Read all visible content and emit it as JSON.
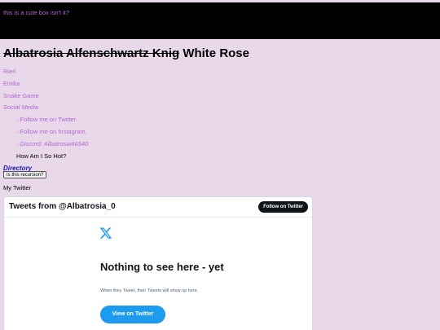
{
  "cute_box": {
    "text": "this is a cute box isn't it?"
  },
  "title": {
    "struck": "Albatrosia Alfenschwartz Knig",
    "rest": " White Rose"
  },
  "nav": {
    "items": [
      {
        "label": "Rieri"
      },
      {
        "label": "Emilia"
      },
      {
        "label": "Snake Game"
      },
      {
        "label": "Social Media"
      }
    ],
    "social": [
      {
        "bullet": "○",
        "label": "Follow me on Twitter."
      },
      {
        "bullet": "○",
        "label": "Follow me on Instagram."
      },
      {
        "bullet": "○",
        "label": "Discord: Albatrosia#6540"
      }
    ],
    "plain": "How Am I So Hot?"
  },
  "directory": {
    "label": "Directory",
    "button_label": "Is this recursion?"
  },
  "my_twitter": "My Twitter",
  "twitter_widget": {
    "header_title": "Tweets from @Albatrosia_0",
    "follow_label": "Follow on Twitter",
    "logo_icon": "x-logo-icon",
    "empty_title": "Nothing to see here - yet",
    "empty_sub": "When they Tweet, their Tweets will show up here.",
    "view_label": "View on Twitter",
    "accent": "#1d9bf0"
  },
  "colors": {
    "background": "#e8d8ea",
    "link": "#b266d6",
    "directory": "#1a14b4"
  }
}
